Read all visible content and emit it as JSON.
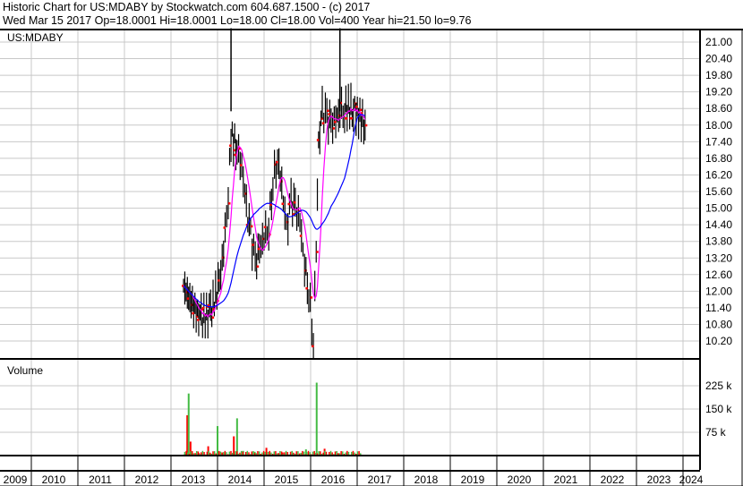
{
  "header": {
    "title": "Historic Chart for US:MDABY by Stockwatch.com 604.687.1500 - (c) 2017",
    "quote": "Wed Mar 15 2017   Op=18.0001   Hi=18.0001   Lo=18.00   Cl=18.00   Vol=400   Year hi=21.50   lo=9.76"
  },
  "chart_data": [
    {
      "type": "line",
      "title": "US:MDABY",
      "ylim": [
        9.8,
        21.5
      ],
      "yticks": [
        "21.00",
        "20.40",
        "19.80",
        "19.20",
        "18.60",
        "18.00",
        "17.40",
        "16.80",
        "16.20",
        "15.60",
        "15.00",
        "14.40",
        "13.80",
        "13.20",
        "12.60",
        "12.00",
        "11.40",
        "10.80",
        "10.20"
      ],
      "series": [
        {
          "name": "price",
          "color": "#000000",
          "points": [
            [
              2013.27,
              12.2
            ],
            [
              2013.46,
              11.5
            ],
            [
              2013.65,
              11.0
            ],
            [
              2013.85,
              11.2
            ],
            [
              2014.04,
              12.3
            ],
            [
              2014.13,
              13.5
            ],
            [
              2014.23,
              15.5
            ],
            [
              2014.29,
              17.6
            ],
            [
              2014.42,
              17.2
            ],
            [
              2014.52,
              16.5
            ],
            [
              2014.62,
              15.0
            ],
            [
              2014.71,
              14.0
            ],
            [
              2014.81,
              13.0
            ],
            [
              2014.9,
              13.5
            ],
            [
              2015.0,
              14.0
            ],
            [
              2015.1,
              14.4
            ],
            [
              2015.19,
              16.0
            ],
            [
              2015.29,
              16.8
            ],
            [
              2015.38,
              15.8
            ],
            [
              2015.48,
              14.2
            ],
            [
              2015.58,
              15.2
            ],
            [
              2015.67,
              15.0
            ],
            [
              2015.77,
              14.5
            ],
            [
              2015.87,
              13.0
            ],
            [
              2015.96,
              12.0
            ],
            [
              2016.06,
              10.3
            ],
            [
              2016.12,
              13.5
            ],
            [
              2016.17,
              17.3
            ],
            [
              2016.25,
              18.5
            ],
            [
              2016.35,
              18.2
            ],
            [
              2016.44,
              18.0
            ],
            [
              2016.54,
              18.2
            ],
            [
              2016.63,
              18.5
            ],
            [
              2016.73,
              18.6
            ],
            [
              2016.92,
              18.6
            ],
            [
              2017.17,
              18.0
            ]
          ]
        },
        {
          "name": "short moving average",
          "color": "#ff00ff"
        },
        {
          "name": "long moving average",
          "color": "#0000ff"
        }
      ],
      "spikes": [
        [
          2014.29,
          21.5
        ],
        [
          2016.63,
          21.5
        ]
      ]
    },
    {
      "type": "bar",
      "title": "Volume",
      "yticks": [
        "225 k",
        "150 k",
        "75 k"
      ],
      "ylim": [
        0,
        260000
      ],
      "up_color": "#44bb44",
      "down_color": "#ff0000",
      "bars": [
        [
          2013.3,
          5000,
          "up"
        ],
        [
          2013.35,
          130000,
          "down"
        ],
        [
          2013.38,
          200000,
          "up"
        ],
        [
          2013.42,
          45000,
          "down"
        ],
        [
          2013.6,
          8000,
          "down"
        ],
        [
          2013.8,
          30000,
          "down"
        ],
        [
          2014.0,
          95000,
          "up"
        ],
        [
          2014.1,
          10000,
          "down"
        ],
        [
          2014.35,
          62000,
          "down"
        ],
        [
          2014.42,
          120000,
          "up"
        ],
        [
          2014.55,
          15000,
          "up"
        ],
        [
          2014.8,
          12000,
          "up"
        ],
        [
          2015.05,
          25000,
          "down"
        ],
        [
          2015.4,
          10000,
          "down"
        ],
        [
          2015.9,
          20000,
          "up"
        ],
        [
          2016.13,
          235000,
          "up"
        ],
        [
          2016.3,
          22000,
          "down"
        ],
        [
          2016.6,
          5000,
          "down"
        ],
        [
          2017.1,
          3000,
          "down"
        ]
      ]
    }
  ],
  "xaxis": {
    "labels": [
      "2009",
      "2010",
      "2011",
      "2012",
      "2013",
      "2014",
      "2015",
      "2016",
      "2017",
      "2018",
      "2019",
      "2020",
      "2021",
      "2022",
      "2023",
      "2024"
    ]
  }
}
